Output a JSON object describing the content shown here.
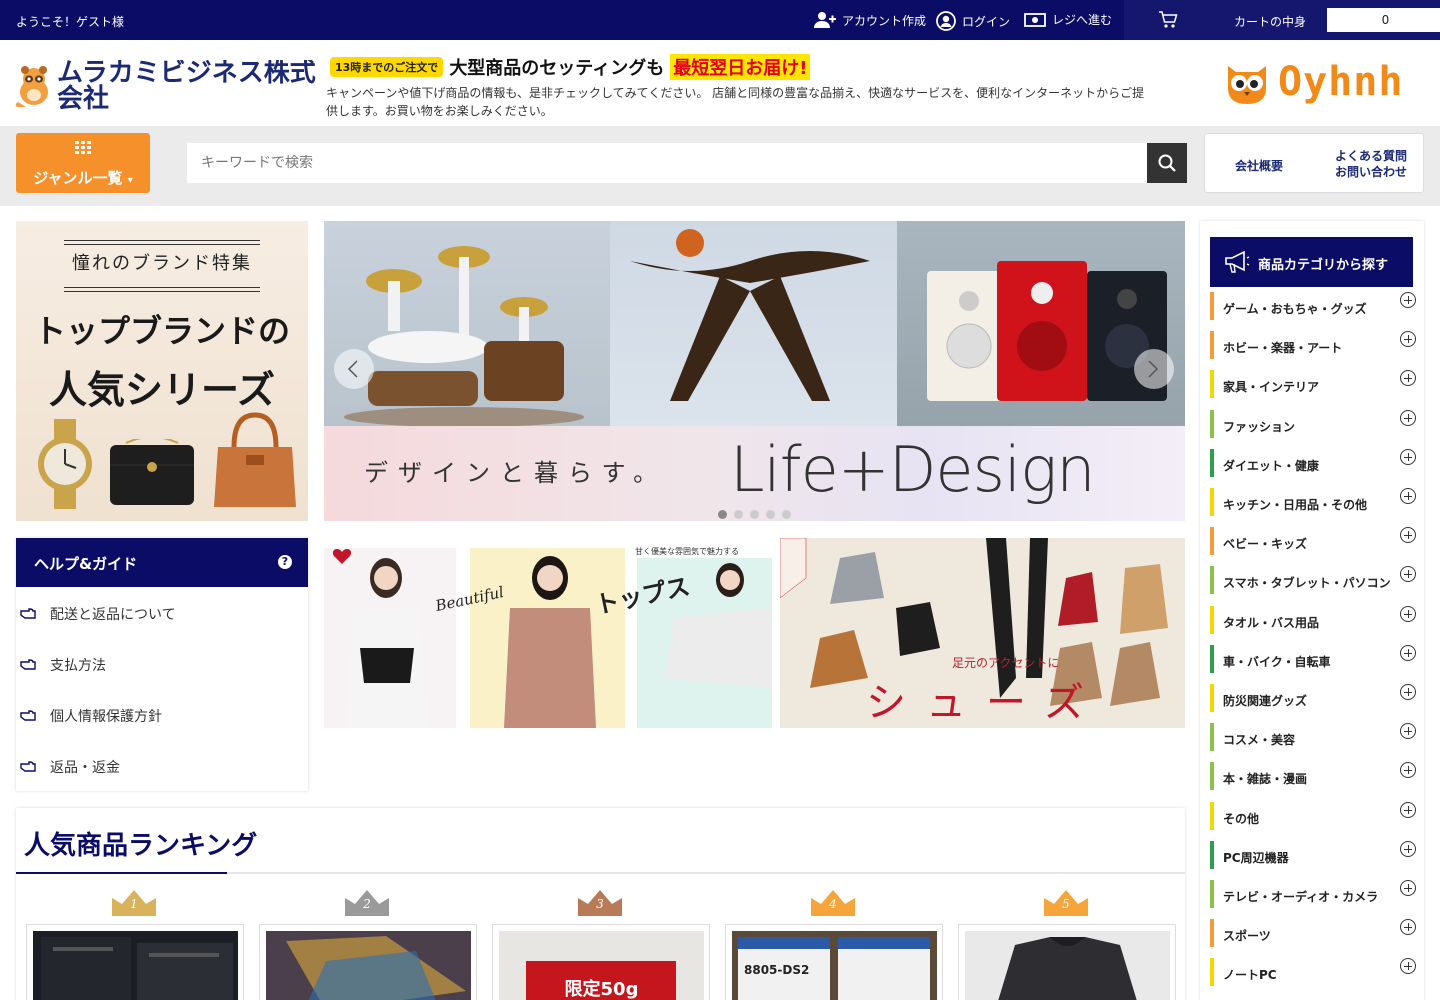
{
  "topbar": {
    "welcome": "ようこそ！ゲスト様",
    "create_account": "アカウント作成",
    "login": "ログイン",
    "checkout": "レジへ進む",
    "cart_label": "カートの中身",
    "cart_count": "0"
  },
  "header": {
    "logo_text": "ムラカミビジネス株式会社",
    "promo_badge": "13時までのご注文で",
    "promo_text": "大型商品のセッティングも",
    "promo_highlight": "最短翌日お届け!",
    "description": "キャンペーンや値下げ商品の情報も、是非チェックしてみてください。 店舗と同様の豊富な品揃え、快適なサービスを、便利なインターネットからご提供します。お買い物をお楽しみください。",
    "brand_name": "Oyhnh"
  },
  "searchbar": {
    "genre_label": "ジャンル一覧",
    "search_placeholder": "キーワードで検索",
    "company_info": "会社概要",
    "faq": "よくある質問",
    "contact": "お問い合わせ"
  },
  "brand_banner": {
    "line1": "憧れのブランド特集",
    "line2": "トップブランドの",
    "line3": "人気シリーズ"
  },
  "hero": {
    "text_jp": "デザインと暮らす。",
    "text_en": "Life+Design",
    "slide_count": 5,
    "active_slide": 1
  },
  "sub_banners": {
    "fashion_word": "Beautiful",
    "fashion_label": "トップス",
    "fashion_tag": "甘く優美な雰囲気で魅力する",
    "shoes_tag": "足元のアクセントに",
    "shoes_label": "シューズ"
  },
  "help": {
    "title": "ヘルプ&ガイド",
    "items": [
      {
        "label": "配送と返品について"
      },
      {
        "label": "支払方法"
      },
      {
        "label": "個人情報保護方針"
      },
      {
        "label": "返品・返金"
      }
    ]
  },
  "ranking": {
    "title": "人気商品ランキング",
    "items": [
      {
        "rank": "1",
        "crown_color": "#d9b25c"
      },
      {
        "rank": "2",
        "crown_color": "#9a9a9a"
      },
      {
        "rank": "3",
        "crown_color": "#b97a57"
      },
      {
        "rank": "4",
        "crown_color": "#f5a53a"
      },
      {
        "rank": "5",
        "crown_color": "#f5a53a"
      }
    ],
    "card3_text": "限定50g",
    "card4_text": "8805-DS2"
  },
  "sidebar": {
    "title": "商品カテゴリから探す",
    "categories": [
      {
        "label": "ゲーム・おもちゃ・グッズ",
        "color": "#f39c3a"
      },
      {
        "label": "ホビー・楽器・アート",
        "color": "#f39c3a"
      },
      {
        "label": "家具・インテリア",
        "color": "#f5d700"
      },
      {
        "label": "ファッション",
        "color": "#8bc34a"
      },
      {
        "label": "ダイエット・健康",
        "color": "#2e9e4f"
      },
      {
        "label": "キッチン・日用品・その他",
        "color": "#f5d700"
      },
      {
        "label": "ベビー・キッズ",
        "color": "#f39c3a"
      },
      {
        "label": "スマホ・タブレット・パソコン",
        "color": "#8bc34a"
      },
      {
        "label": "タオル・バス用品",
        "color": "#f5d700"
      },
      {
        "label": "車・バイク・自転車",
        "color": "#2e9e4f"
      },
      {
        "label": "防災関連グッズ",
        "color": "#f5d700"
      },
      {
        "label": "コスメ・美容",
        "color": "#8bc34a"
      },
      {
        "label": "本・雑誌・漫画",
        "color": "#8bc34a"
      },
      {
        "label": "その他",
        "color": "#f5d700"
      },
      {
        "label": "PC周辺機器",
        "color": "#2e9e4f"
      },
      {
        "label": "テレビ・オーディオ・カメラ",
        "color": "#8bc34a"
      },
      {
        "label": "スポーツ",
        "color": "#f39c3a"
      },
      {
        "label": "ノートPC",
        "color": "#f5d700"
      }
    ]
  }
}
